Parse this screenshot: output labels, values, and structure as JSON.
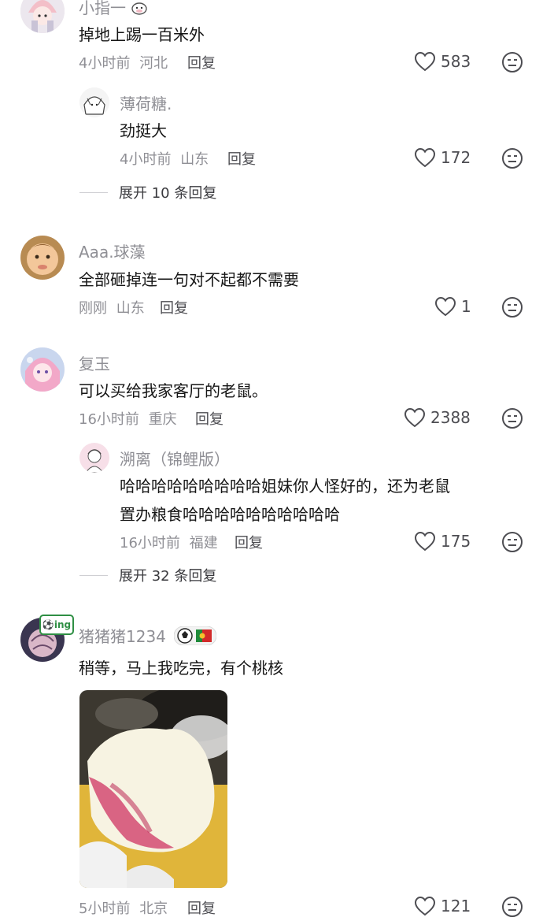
{
  "comments": [
    {
      "user": "小指一",
      "text": "掉地上踢一百米外",
      "time": "4小时前",
      "loc": "河北",
      "reply": "回复",
      "likes": "583"
    },
    {
      "user": "薄荷糖.",
      "text": "劲挺大",
      "time": "4小时前",
      "loc": "山东",
      "reply": "回复",
      "likes": "172",
      "expand": "展开 10 条回复"
    },
    {
      "user": "Aaa.球藻",
      "text": "全部砸掉连一句对不起都不需要",
      "time": "刚刚",
      "loc": "山东",
      "reply": "回复",
      "likes": "1"
    },
    {
      "user": "复玉",
      "text": "可以买给我家客厅的老鼠。",
      "time": "16小时前",
      "loc": "重庆",
      "reply": "回复",
      "likes": "2388"
    },
    {
      "user": "溯离（锦鲤版）",
      "text_line1": "哈哈哈哈哈哈哈哈哈姐妹你人怪好的，还为老鼠",
      "text_line2": "置办粮食哈哈哈哈哈哈哈哈哈哈",
      "time": "16小时前",
      "loc": "福建",
      "reply": "回复",
      "likes": "175",
      "expand": "展开 32 条回复"
    },
    {
      "user": "猪猪猪1234",
      "text": "稍等，马上我吃完，有个桃核",
      "time": "5小时前",
      "loc": "北京",
      "reply": "回复",
      "likes": "121",
      "avatar_badge": "ing"
    }
  ],
  "colors": {
    "text": "#161616",
    "meta": "#8f8f95",
    "accent": "#4d4d52"
  },
  "icons": {
    "like": "heart-outline-icon",
    "dislike": "unamused-face-icon"
  }
}
